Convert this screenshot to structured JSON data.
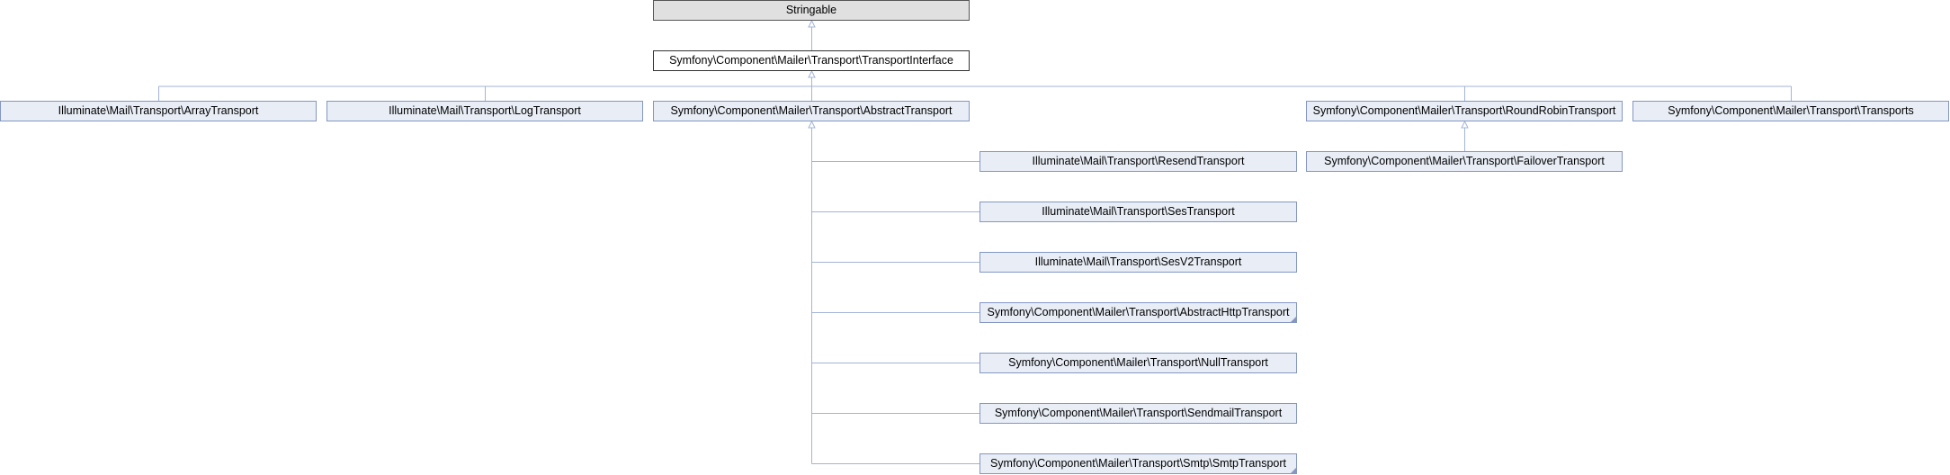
{
  "diagram": {
    "edge_color": "#a3b4d7",
    "nodes": {
      "stringable": "Stringable",
      "transport_interface": "Symfony\\Component\\Mailer\\Transport\\TransportInterface",
      "array_transport": "Illuminate\\Mail\\Transport\\ArrayTransport",
      "log_transport": "Illuminate\\Mail\\Transport\\LogTransport",
      "abstract_transport": "Symfony\\Component\\Mailer\\Transport\\AbstractTransport",
      "round_robin_transport": "Symfony\\Component\\Mailer\\Transport\\RoundRobinTransport",
      "transports": "Symfony\\Component\\Mailer\\Transport\\Transports",
      "failover_transport": "Symfony\\Component\\Mailer\\Transport\\FailoverTransport",
      "resend_transport": "Illuminate\\Mail\\Transport\\ResendTransport",
      "ses_transport": "Illuminate\\Mail\\Transport\\SesTransport",
      "ses_v2_transport": "Illuminate\\Mail\\Transport\\SesV2Transport",
      "abstract_http_transport": "Symfony\\Component\\Mailer\\Transport\\AbstractHttpTransport",
      "null_transport": "Symfony\\Component\\Mailer\\Transport\\NullTransport",
      "sendmail_transport": "Symfony\\Component\\Mailer\\Transport\\SendmailTransport",
      "smtp_transport": "Symfony\\Component\\Mailer\\Transport\\Smtp\\SmtpTransport"
    }
  }
}
